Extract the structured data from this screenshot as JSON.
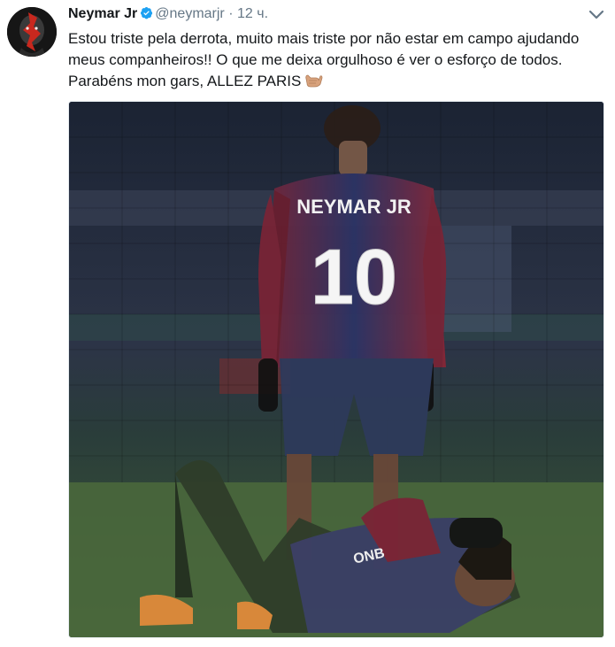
{
  "author": {
    "name": "Neymar Jr",
    "handle": "@neymarjr",
    "separator": "·",
    "time": "12 ч."
  },
  "tweet": {
    "line1": "Estou triste pela derrota, muito mais triste por não estar em campo ajudando",
    "line2": "meus companheiros!! O que me deixa orgulhoso é ver o esforço de todos.",
    "line3": "Parabéns mon gars, ALLEZ PARIS"
  },
  "media": {
    "jersey_name": "NEYMAR JR",
    "jersey_number": "10",
    "kit_sponsor": "ONB"
  },
  "icons": {
    "verified": "verified-badge-icon",
    "menu": "chevron-down-icon",
    "emoji": "call-me-hand-emoji-icon"
  },
  "colors": {
    "verified_blue": "#1da1f2",
    "text": "#14171a",
    "muted": "#657786"
  }
}
